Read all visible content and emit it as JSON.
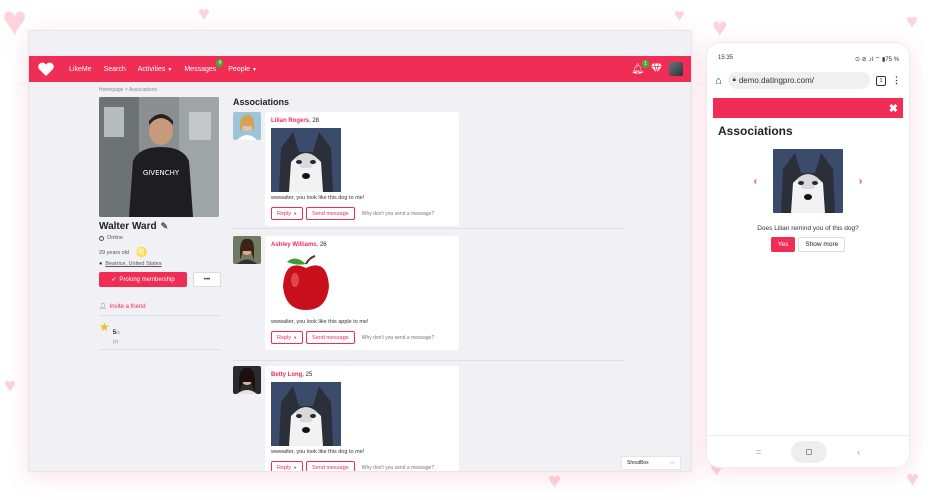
{
  "colors": {
    "accent": "#f02d55",
    "page_bg": "#f1f0f5",
    "heart_bg": "#fbd4dc"
  },
  "nav": {
    "logo_icon": "heart-icon",
    "items": [
      {
        "label": "LikeMe"
      },
      {
        "label": "Search"
      },
      {
        "label": "Activities",
        "has_caret": true
      },
      {
        "label": "Messages",
        "badge": "4"
      },
      {
        "label": "People",
        "has_caret": true
      }
    ],
    "notifications_badge": "1",
    "icons": [
      "bell-icon",
      "gem-icon",
      "user-avatar"
    ]
  },
  "breadcrumb": {
    "home": "Homepage",
    "separator": ">",
    "current": "Associations"
  },
  "profile": {
    "name": "Walter Ward",
    "status": "Online",
    "age": "29 years old",
    "zodiac_glyph": "♌",
    "location": "Beatrice, United States",
    "prolong_label": "Prolong membership",
    "more_label": "•••",
    "invite_label": "Invite a friend",
    "rating_value": "5",
    "rating_max": "/5",
    "rating_count": "(2)"
  },
  "main": {
    "title": "Associations",
    "items": [
      {
        "name": "Lilian Rogers",
        "age": ", 28",
        "image": "husky",
        "text": "wwwalter, you look like this dog to me!",
        "reply": "Reply",
        "send": "Send message",
        "hint": "Why don't you send a message?"
      },
      {
        "name": "Ashley Williams",
        "age": ", 26",
        "image": "apple",
        "text": "wwwalter, you look like this apple to me!",
        "reply": "Reply",
        "send": "Send message",
        "hint": "Why don't you send a message?"
      },
      {
        "name": "Betty Long",
        "age": ", 25",
        "image": "husky",
        "text": "wwwalter, you look like this dog to me!",
        "reply": "Reply",
        "send": "Send message",
        "hint": "Why don't you send a message?"
      }
    ]
  },
  "shoutbox": {
    "label": "ShoutBox"
  },
  "mobile": {
    "time": "15:35",
    "status_icons": "⊙ ⊘ .ıl ⌔ ▮75 %",
    "url": "demo.datingpro.com/",
    "tab_count": "1",
    "close": "✖",
    "title": "Associations",
    "question": "Does Lilian remind you of this dog?",
    "yes": "Yes",
    "more": "Show more",
    "prev_arrow": "‹",
    "next_arrow": "›",
    "nav_lines": "=",
    "nav_back": "‹"
  }
}
